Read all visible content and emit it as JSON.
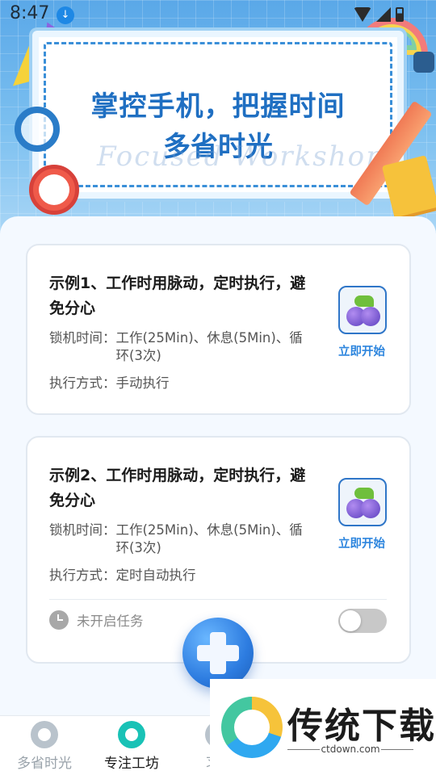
{
  "status_bar": {
    "time": "8:47"
  },
  "banner": {
    "title_line1": "掌控手机，把握时间",
    "title_line2": "多省时光",
    "watermark": "Focused  Workshop"
  },
  "cards": [
    {
      "title": "示例1、工作时用脉动，定时执行，避免分心",
      "lock_time_label": "锁机时间：",
      "lock_time_value": "工作(25Min)、休息(5Min)、循环(3次)",
      "mode_label": "执行方式：",
      "mode_value": "手动执行",
      "start_label": "立即开始",
      "icon": "blueberry-app-icon"
    },
    {
      "title": "示例2、工作时用脉动，定时执行，避免分心",
      "lock_time_label": "锁机时间：",
      "lock_time_value": "工作(25Min)、休息(5Min)、循环(3次)",
      "mode_label": "执行方式：",
      "mode_value": "定时自动执行",
      "start_label": "立即开始",
      "icon": "blueberry-app-icon",
      "task_status": "未开启任务",
      "toggle_on": false
    }
  ],
  "fab": {
    "icon": "plus-icon"
  },
  "bottom_nav": [
    {
      "label": "多省时光",
      "icon": "alarm-clock-icon",
      "active": false
    },
    {
      "label": "专注工坊",
      "icon": "bulb-icon",
      "active": true
    },
    {
      "label": "习惯",
      "icon": "habit-icon",
      "active": false
    }
  ],
  "overlay": {
    "title": "传统下载",
    "subtitle": "ctdown.com"
  },
  "colors": {
    "accent": "#2e86de",
    "active_nav": "#19c2b6",
    "banner_text": "#1f6fc2"
  }
}
